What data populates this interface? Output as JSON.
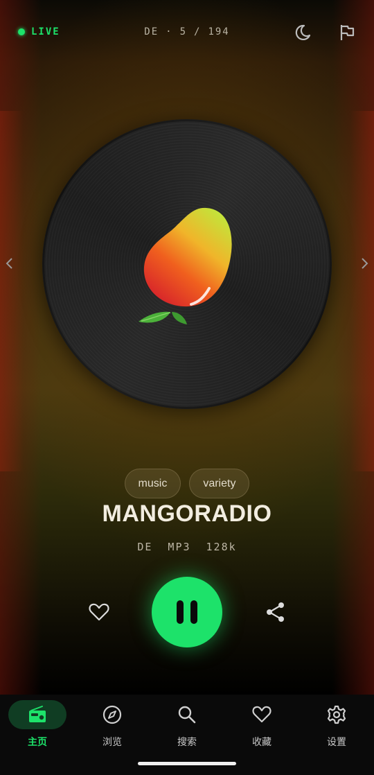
{
  "status": {
    "live_label": "LIVE",
    "country": "DE",
    "separator": "·",
    "current_index": "5",
    "slash": "/",
    "total": "194"
  },
  "station": {
    "tags": [
      "music",
      "variety"
    ],
    "name": "MANGORADIO",
    "country": "DE",
    "codec": "MP3",
    "bitrate": "128k",
    "playing": true
  },
  "icons": {
    "theme": "moon-icon",
    "report": "flag-icon",
    "prev": "chevron-left-icon",
    "next": "chevron-right-icon",
    "favorite": "heart-icon",
    "share": "share-icon",
    "play_state": "pause-icon"
  },
  "bottom_nav": [
    {
      "label": "主页",
      "icon": "radio-icon",
      "active": true
    },
    {
      "label": "浏览",
      "icon": "compass-icon",
      "active": false
    },
    {
      "label": "搜索",
      "icon": "search-icon",
      "active": false
    },
    {
      "label": "收藏",
      "icon": "heart-icon",
      "active": false
    },
    {
      "label": "设置",
      "icon": "gear-icon",
      "active": false
    }
  ],
  "colors": {
    "accent": "#1de26a",
    "nav_active_bg": "#103d23"
  }
}
